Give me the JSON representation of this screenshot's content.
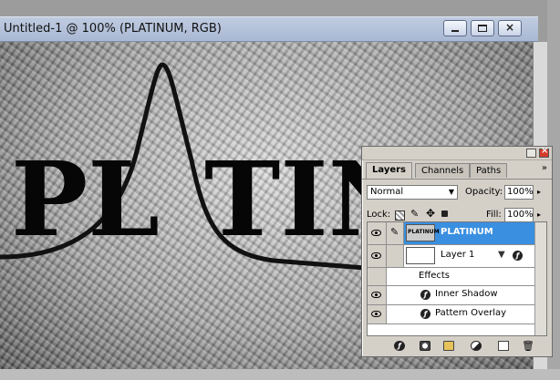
{
  "document": {
    "title": "Untitled-1 @ 100% (PLATINUM, RGB)",
    "canvas_text": "PL",
    "canvas_text_2": "TIN"
  },
  "layers_panel": {
    "tabs": [
      "Layers",
      "Channels",
      "Paths"
    ],
    "active_tab": "Layers",
    "blend_mode": "Normal",
    "opacity_label": "Opacity:",
    "opacity_value": "100%",
    "lock_label": "Lock:",
    "fill_label": "Fill:",
    "fill_value": "100%",
    "layers": [
      {
        "name": "PLATINUM",
        "selected": true,
        "thumb_text": "PLATINUM"
      },
      {
        "name": "Layer 1",
        "selected": false
      }
    ],
    "effects_label": "Effects",
    "effects": [
      "Inner Shadow",
      "Pattern Overlay"
    ]
  },
  "colors": {
    "selection": "#3a8fe0",
    "panel_bg": "#d4d0c8",
    "titlebar": "#a9b8d3"
  }
}
